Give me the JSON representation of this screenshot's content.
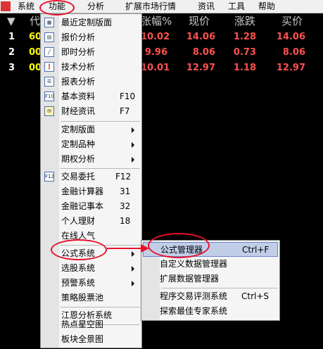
{
  "menubar": {
    "items": [
      "系统",
      "功能",
      "分析",
      "扩展市场行情",
      "资讯",
      "工具",
      "帮助"
    ]
  },
  "table": {
    "headers": {
      "sort": "▼",
      "code": "代",
      "change_pct": "张幅%",
      "price": "现价",
      "change": "涨跌",
      "bid": "买价"
    },
    "rows": [
      {
        "num": "1",
        "code": "60",
        "change_pct": "10.02",
        "price": "14.06",
        "change": "1.28",
        "bid": "14.06"
      },
      {
        "num": "2",
        "code": "00",
        "change_pct": "9.96",
        "price": "8.06",
        "change": "0.73",
        "bid": "8.06"
      },
      {
        "num": "3",
        "code": "00",
        "change_pct": "10.01",
        "price": "12.97",
        "change": "1.18",
        "bid": "12.97"
      }
    ]
  },
  "function_menu": {
    "items": [
      {
        "label": "最近定制版面",
        "icon": "recent-layout-icon"
      },
      {
        "label": "报价分析",
        "icon": "quote-table-icon"
      },
      {
        "label": "即时分析",
        "icon": "line-chart-icon"
      },
      {
        "label": "技术分析",
        "icon": "candlestick-icon"
      },
      {
        "label": "报表分析",
        "icon": "report-icon"
      },
      {
        "label": "基本资料",
        "shortcut": "F10",
        "icon": "f10-icon"
      },
      {
        "label": "财经资讯",
        "shortcut": "F7",
        "icon": "news-icon"
      },
      {
        "label": "定制版面"
      },
      {
        "label": "定制品种"
      },
      {
        "label": "期权分析"
      },
      {
        "label": "交易委托",
        "shortcut": "F12",
        "icon": "f12-icon"
      },
      {
        "label": "金融计算器",
        "shortcut": "31"
      },
      {
        "label": "金融记事本",
        "shortcut": "32"
      },
      {
        "label": "个人理财",
        "shortcut": "18"
      },
      {
        "label": "在线人气"
      },
      {
        "label": "公式系统"
      },
      {
        "label": "选股系统"
      },
      {
        "label": "预警系统"
      },
      {
        "label": "策略股票池"
      },
      {
        "label": "江恩分析系统"
      },
      {
        "label": "热点星空图"
      },
      {
        "label": "板块全景图"
      }
    ]
  },
  "formula_submenu": {
    "items": [
      {
        "label": "公式管理器",
        "shortcut": "Ctrl+F"
      },
      {
        "label": "自定义数据管理器"
      },
      {
        "label": "扩展数据管理器"
      },
      {
        "label": "程序交易评测系统",
        "shortcut": "Ctrl+S"
      },
      {
        "label": "探索最佳专家系统"
      }
    ]
  },
  "colors": {
    "background": "#000000",
    "price_red": "#ff5050",
    "code_yellow": "#ffff00",
    "annotation_red": "#e8102a",
    "menu_highlight": "#c2cee8"
  }
}
